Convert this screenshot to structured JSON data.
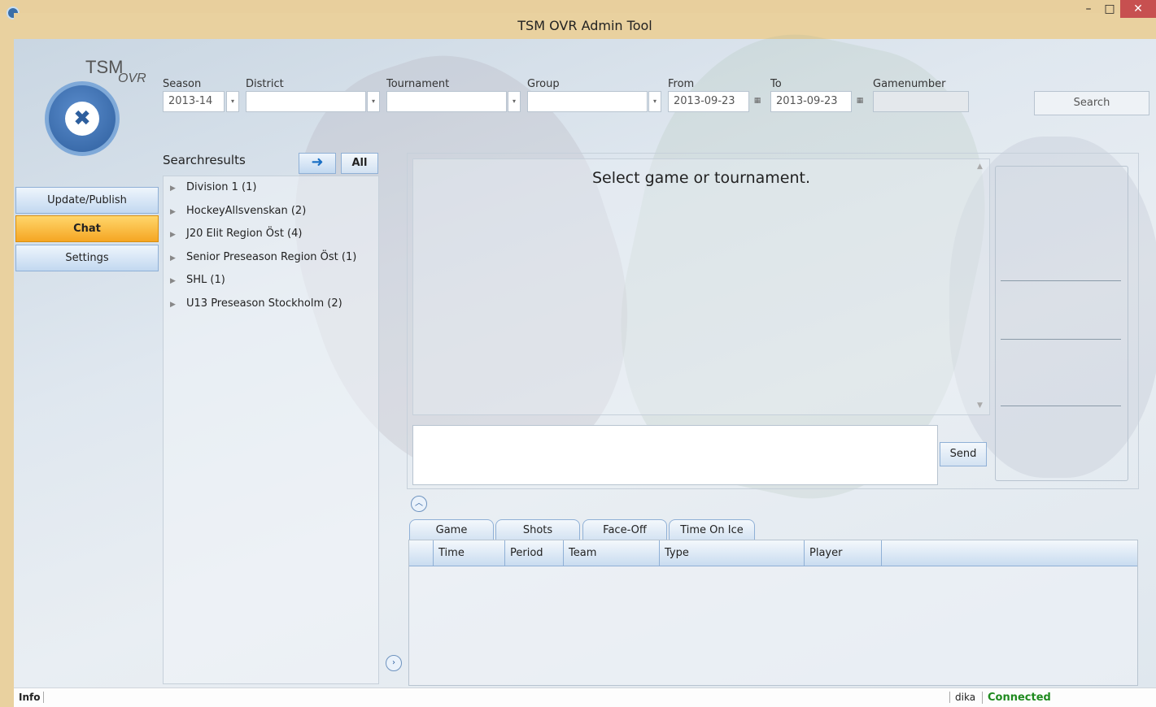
{
  "window": {
    "title": "TSM OVR Admin Tool",
    "min": "–",
    "max": "□",
    "close": "✕"
  },
  "logo": {
    "title": "TSM",
    "subtitle": "OVR"
  },
  "filters": {
    "season_label": "Season",
    "season_value": "2013-14",
    "district_label": "District",
    "district_value": "",
    "tournament_label": "Tournament",
    "tournament_value": "",
    "group_label": "Group",
    "group_value": "",
    "from_label": "From",
    "from_value": "2013-09-23",
    "to_label": "To",
    "to_value": "2013-09-23",
    "gamenumber_label": "Gamenumber",
    "gamenumber_value": "",
    "search_label": "Search"
  },
  "nav": [
    {
      "label": "Update/Publish"
    },
    {
      "label": "Chat"
    },
    {
      "label": "Settings"
    }
  ],
  "searchresults": {
    "title": "Searchresults",
    "all_label": "All",
    "items": [
      {
        "label": "Division 1 (1)"
      },
      {
        "label": "HockeyAllsvenskan (2)"
      },
      {
        "label": "J20 Elit Region Öst (4)"
      },
      {
        "label": "Senior Preseason Region Öst (1)"
      },
      {
        "label": "SHL (1)"
      },
      {
        "label": "U13 Preseason Stockholm (2)"
      }
    ]
  },
  "chat": {
    "message": "Select game or tournament.",
    "send_label": "Send"
  },
  "tabs": [
    {
      "label": "Game"
    },
    {
      "label": "Shots"
    },
    {
      "label": "Face-Off"
    },
    {
      "label": "Time On Ice"
    }
  ],
  "grid": {
    "columns": [
      "Time",
      "Period",
      "Team",
      "Type",
      "Player"
    ]
  },
  "status": {
    "info": "Info",
    "user": "dika",
    "connection": "Connected"
  },
  "colors": {
    "active_nav": "#f5a623",
    "connected": "#1f8a1f",
    "close_button": "#c75050"
  }
}
